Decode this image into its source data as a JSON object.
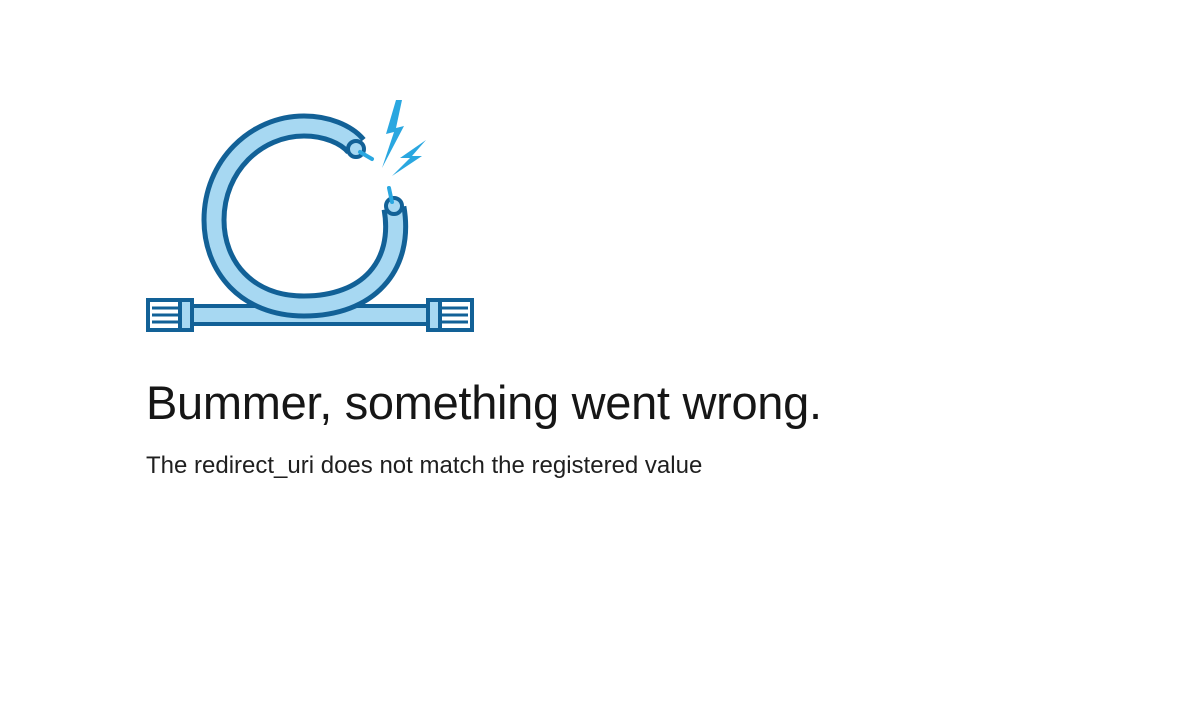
{
  "error": {
    "illustration": "disconnected-cable-icon",
    "title": "Bummer, something went wrong.",
    "message": "The redirect_uri does not match the registered value"
  },
  "colors": {
    "cable_fill": "#a7d8f2",
    "cable_stroke": "#126197",
    "spark": "#2aa7e0",
    "text": "#161616",
    "background": "#ffffff"
  }
}
